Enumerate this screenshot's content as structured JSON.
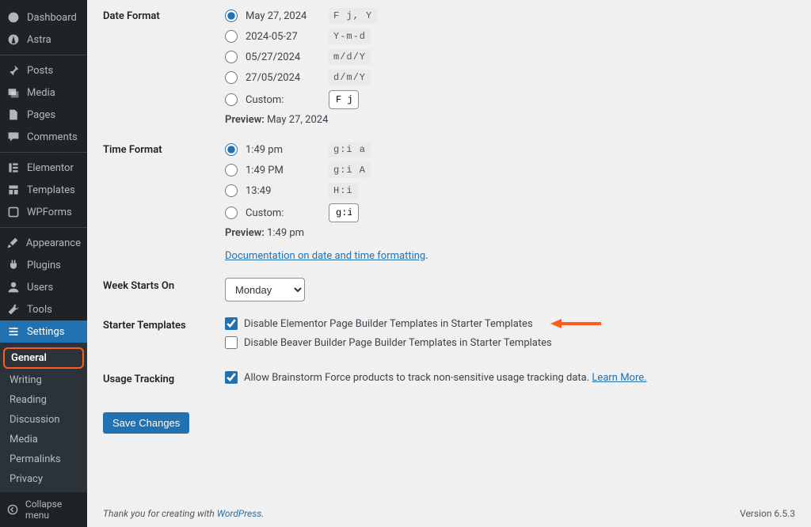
{
  "sidebar": {
    "items": [
      {
        "label": "Dashboard"
      },
      {
        "label": "Astra"
      },
      {
        "label": "Posts"
      },
      {
        "label": "Media"
      },
      {
        "label": "Pages"
      },
      {
        "label": "Comments"
      },
      {
        "label": "Elementor"
      },
      {
        "label": "Templates"
      },
      {
        "label": "WPForms"
      },
      {
        "label": "Appearance"
      },
      {
        "label": "Plugins"
      },
      {
        "label": "Users"
      },
      {
        "label": "Tools"
      },
      {
        "label": "Settings"
      }
    ],
    "sub": [
      {
        "label": "General"
      },
      {
        "label": "Writing"
      },
      {
        "label": "Reading"
      },
      {
        "label": "Discussion"
      },
      {
        "label": "Media"
      },
      {
        "label": "Permalinks"
      },
      {
        "label": "Privacy"
      }
    ],
    "collapse": "Collapse menu"
  },
  "dateFormat": {
    "label": "Date Format",
    "options": [
      {
        "label": "May 27, 2024",
        "code": "F j, Y"
      },
      {
        "label": "2024-05-27",
        "code": "Y-m-d"
      },
      {
        "label": "05/27/2024",
        "code": "m/d/Y"
      },
      {
        "label": "27/05/2024",
        "code": "d/m/Y"
      }
    ],
    "customLabel": "Custom:",
    "customValue": "F j, Y",
    "previewLabel": "Preview:",
    "previewValue": "May 27, 2024"
  },
  "timeFormat": {
    "label": "Time Format",
    "options": [
      {
        "label": "1:49 pm",
        "code": "g:i a"
      },
      {
        "label": "1:49 PM",
        "code": "g:i A"
      },
      {
        "label": "13:49",
        "code": "H:i"
      }
    ],
    "customLabel": "Custom:",
    "customValue": "g:i a",
    "previewLabel": "Preview:",
    "previewValue": "1:49 pm",
    "docLink": "Documentation on date and time formatting"
  },
  "weekStarts": {
    "label": "Week Starts On",
    "value": "Monday"
  },
  "starterTemplates": {
    "label": "Starter Templates",
    "opt1": "Disable Elementor Page Builder Templates in Starter Templates",
    "opt2": "Disable Beaver Builder Page Builder Templates in Starter Templates"
  },
  "usageTracking": {
    "label": "Usage Tracking",
    "text": "Allow Brainstorm Force products to track non-sensitive usage tracking data. ",
    "learnMore": "Learn More."
  },
  "saveBtn": "Save Changes",
  "footer": {
    "thankPrefix": "Thank you for creating with ",
    "wp": "WordPress",
    "version": "Version 6.5.3"
  },
  "colors": {
    "accent": "#2271b1",
    "arrow": "#ff5a1f"
  }
}
